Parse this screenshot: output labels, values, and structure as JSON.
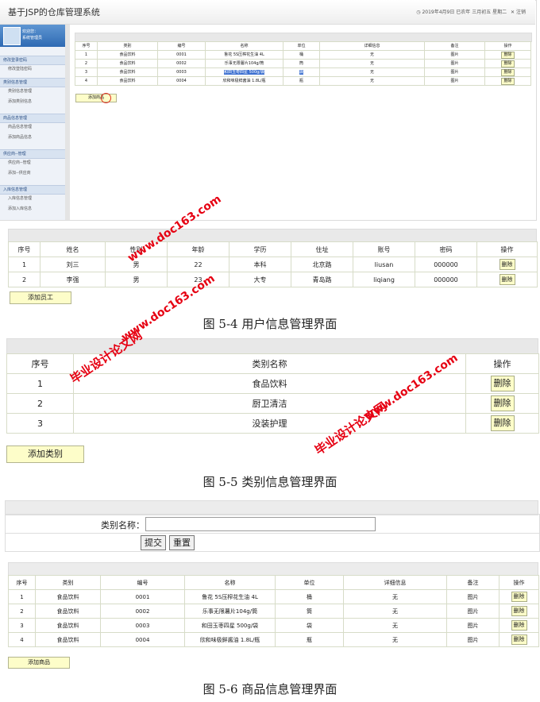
{
  "panel1": {
    "system_title": "基于JSP的仓库管理系统",
    "header_info": "2019年4月9日 已农年 三月初五 星期二",
    "logout": "注销",
    "welcome": "欢迎您：",
    "user": "系统管理员",
    "sidebar": [
      {
        "group": "修改登录密码",
        "items": [
          "修改登陆密码"
        ]
      },
      {
        "group": "类别信息管理",
        "items": [
          "类别信息管理",
          "添加类别信息"
        ]
      },
      {
        "group": "商品信息管理",
        "items": [
          "商品信息管理",
          "添加商品信息"
        ]
      },
      {
        "group": "供应商--管理",
        "items": [
          "供应商--管理",
          "添加--供应商"
        ]
      },
      {
        "group": "入库信息管理",
        "items": [
          "入库信息管理",
          "添加入库信息"
        ]
      }
    ],
    "columns": [
      "序号",
      "类别",
      "编号",
      "名称",
      "单位",
      "详细信息",
      "备注",
      "操作"
    ],
    "rows": [
      [
        "1",
        "食品饮料",
        "0001",
        "鲁花 5S压榨花生油 4L",
        "桶",
        "无",
        "图片"
      ],
      [
        "2",
        "食品饮料",
        "0002",
        "乐事无限薯片104g/筒",
        "筒",
        "无",
        "图片"
      ],
      [
        "3",
        "食品饮料",
        "0003",
        "和田玉枣四星 500g/袋",
        "袋",
        "无",
        "图片"
      ],
      [
        "4",
        "食品饮料",
        "0004",
        "欣和味极鲜酱油 1.8L/瓶",
        "瓶",
        "无",
        "图片"
      ]
    ],
    "delete_label": "删除",
    "add_label": "添加商品"
  },
  "panel2": {
    "columns": [
      "序号",
      "姓名",
      "性别",
      "年龄",
      "学历",
      "住址",
      "账号",
      "密码",
      "操作"
    ],
    "rows": [
      [
        "1",
        "刘三",
        "男",
        "22",
        "本科",
        "北京路",
        "liusan",
        "000000"
      ],
      [
        "2",
        "李强",
        "男",
        "23",
        "大专",
        "青岛路",
        "liqiang",
        "000000"
      ]
    ],
    "delete_label": "删除",
    "add_label": "添加员工",
    "caption": "图 5-4 用户信息管理界面"
  },
  "panel3": {
    "columns": [
      "序号",
      "类别名称",
      "操作"
    ],
    "rows": [
      [
        "1",
        "食品饮料"
      ],
      [
        "2",
        "厨卫清洁"
      ],
      [
        "3",
        "没装护理"
      ]
    ],
    "delete_label": "删除",
    "add_label": "添加类别",
    "caption": "图 5-5 类别信息管理界面"
  },
  "panel4": {
    "field_label": "类别名称：",
    "submit_label": "提交",
    "reset_label": "重置"
  },
  "panel5": {
    "columns": [
      "序号",
      "类别",
      "编号",
      "名称",
      "单位",
      "详细信息",
      "备注",
      "操作"
    ],
    "rows": [
      [
        "1",
        "食品饮料",
        "0001",
        "鲁花 5S压榨花生油 4L",
        "桶",
        "无",
        "图片"
      ],
      [
        "2",
        "食品饮料",
        "0002",
        "乐事无限薯片104g/筒",
        "筒",
        "无",
        "图片"
      ],
      [
        "3",
        "食品饮料",
        "0003",
        "和田玉枣四星 500g/袋",
        "袋",
        "无",
        "图片"
      ],
      [
        "4",
        "食品饮料",
        "0004",
        "欣和味极鲜酱油 1.8L/瓶",
        "瓶",
        "无",
        "图片"
      ]
    ],
    "delete_label": "删除",
    "add_label": "添加商品",
    "caption": "图 5-6 商品信息管理界面"
  },
  "watermark": {
    "site": "www.doc163.com",
    "name": "毕业设计论文网"
  },
  "colors": {
    "button_bg": "#fdfdc9",
    "header_bg": "#e9e9e9",
    "sidebar_blue": "#2e6ab3",
    "watermark_red": "#e60012"
  }
}
